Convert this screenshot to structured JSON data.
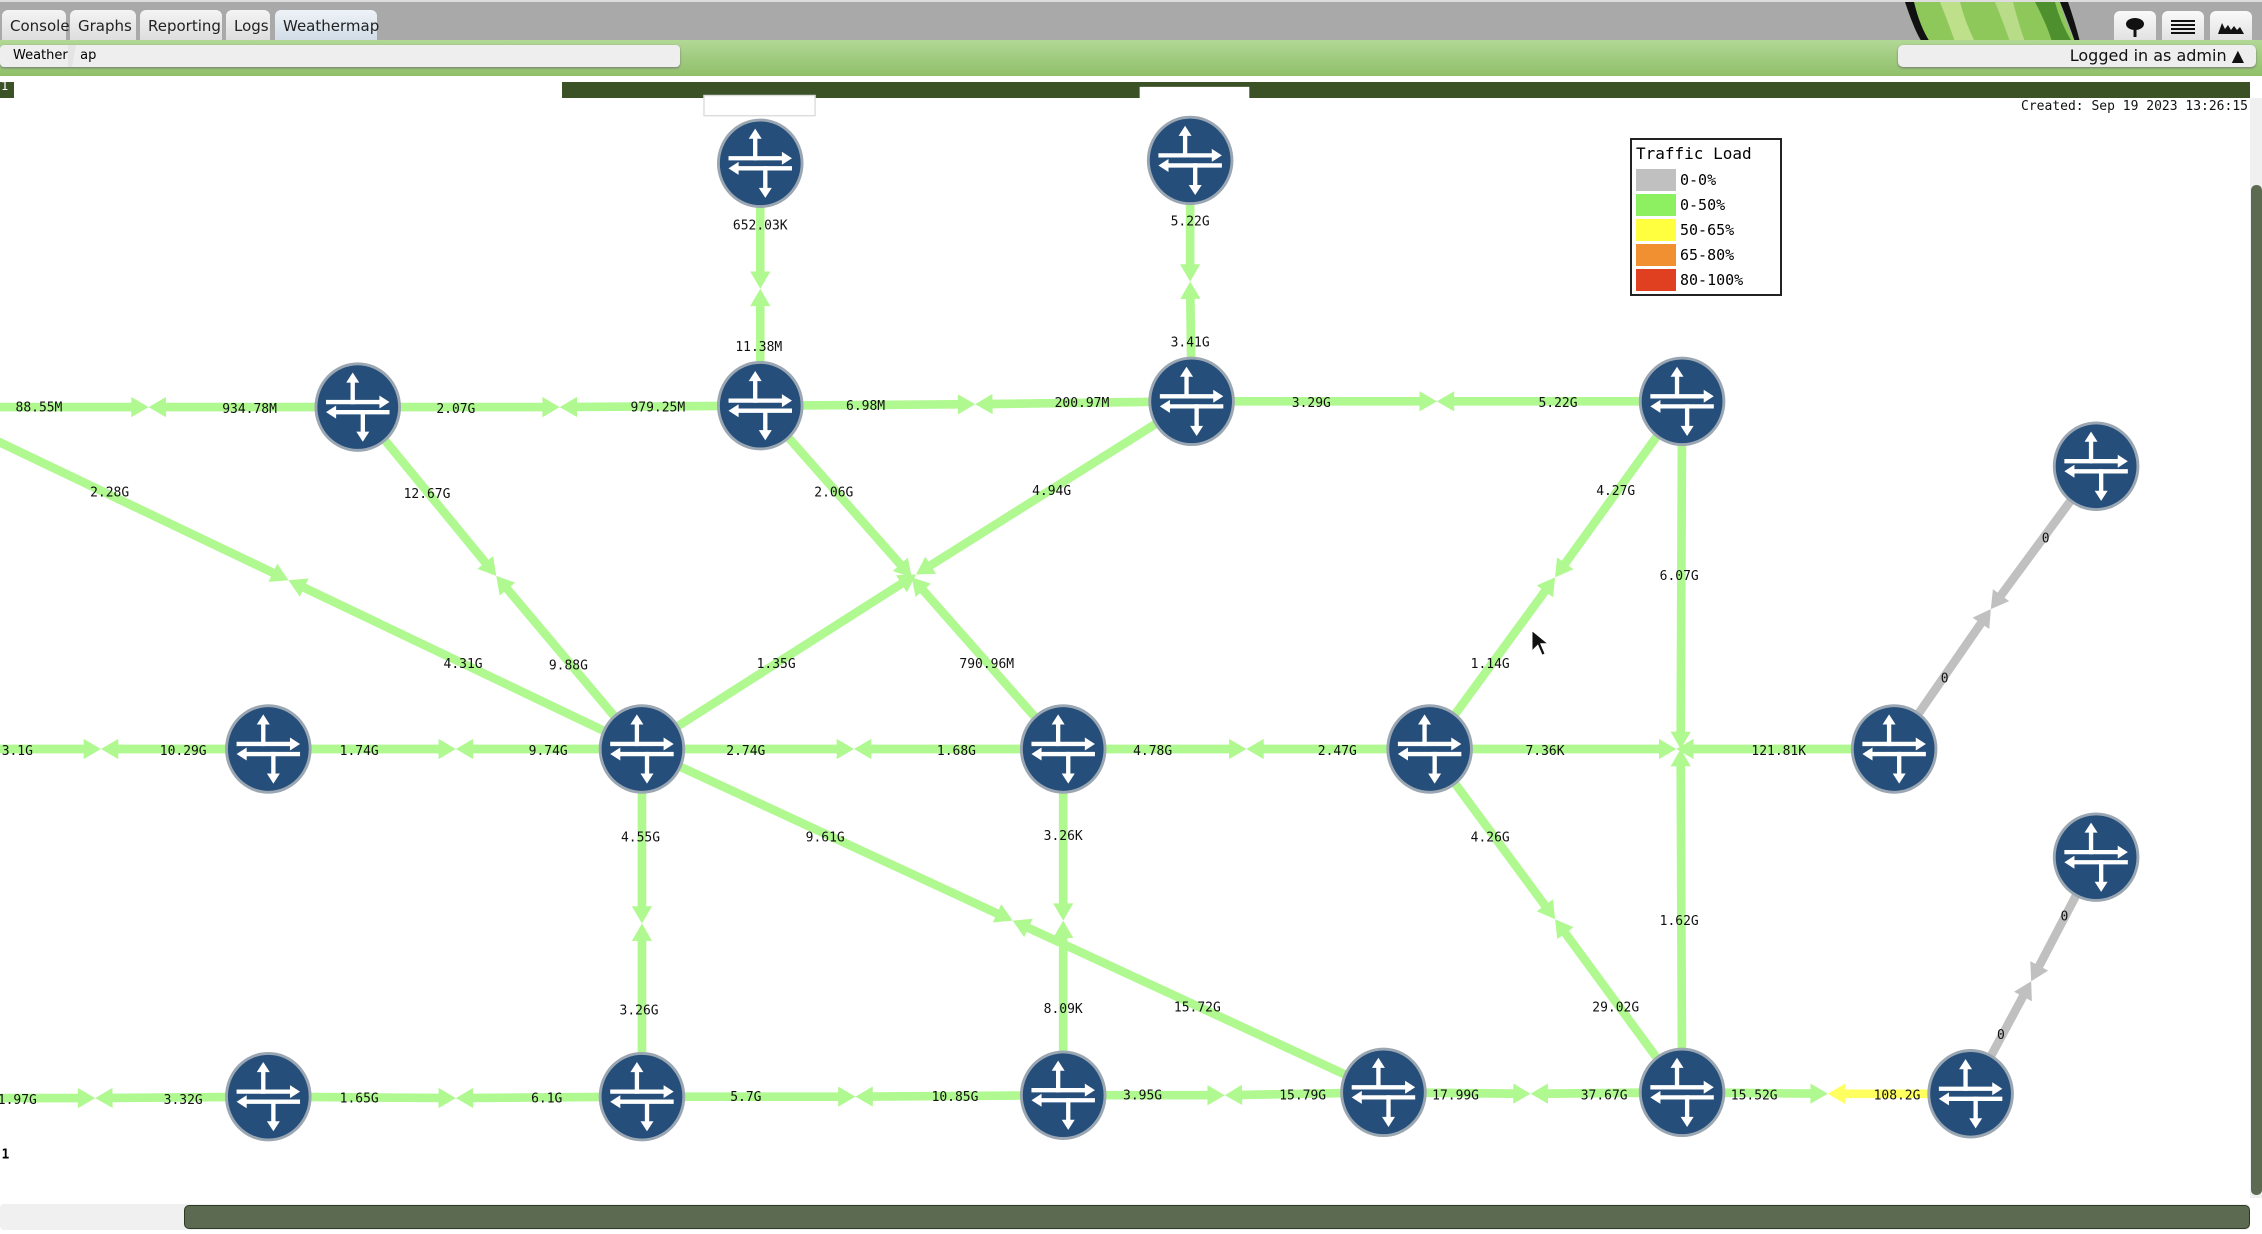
{
  "nav": {
    "tabs": [
      {
        "label": "Console",
        "active": false
      },
      {
        "label": "Graphs",
        "active": false
      },
      {
        "label": "Reporting",
        "active": false
      },
      {
        "label": "Logs",
        "active": false
      },
      {
        "label": "Weathermap",
        "active": true
      }
    ],
    "icons": [
      "tree-icon",
      "menu-icon",
      "chart-icon"
    ],
    "breadcrumb": "Weathermap",
    "login_text": "Logged in as admin ▲"
  },
  "map": {
    "corner_label_top": "1",
    "corner_label_bottom": "1",
    "created": "Created: Sep 19 2023 13:26:15",
    "node_icon": "router-icon",
    "node_color": "#254e7a",
    "legend": {
      "title": "Traffic Load",
      "items": [
        {
          "label": "0-0%",
          "color": "#c0c0c0"
        },
        {
          "label": "0-50%",
          "color": "#8cf060"
        },
        {
          "label": "50-65%",
          "color": "#ffff40"
        },
        {
          "label": "65-80%",
          "color": "#f09030"
        },
        {
          "label": "80-100%",
          "color": "#e04020"
        }
      ]
    },
    "links": [
      {
        "a": "88.55M",
        "b": "934.78M",
        "a_load": "0-50%",
        "b_load": "0-50%"
      },
      {
        "a": "2.07G",
        "b": "979.25M",
        "a_load": "0-50%",
        "b_load": "0-50%"
      },
      {
        "a": "6.98M",
        "b": "200.97M",
        "a_load": "0-50%",
        "b_load": "0-50%"
      },
      {
        "a": "3.29G",
        "b": "5.22G",
        "a_load": "0-50%",
        "b_load": "0-50%"
      },
      {
        "a": "652.03K",
        "b": "11.38M",
        "a_load": "0-50%",
        "b_load": "0-50%"
      },
      {
        "a": "5.22G",
        "b": "3.41G",
        "a_load": "0-50%",
        "b_load": "0-50%"
      },
      {
        "a": "2.28G",
        "b": "4.31G",
        "a_load": "0-50%",
        "b_load": "0-50%"
      },
      {
        "a": "12.67G",
        "b": "9.88G",
        "a_load": "0-50%",
        "b_load": "0-50%"
      },
      {
        "a": "2.06G",
        "b": "790.96M",
        "a_load": "0-50%",
        "b_load": "0-50%"
      },
      {
        "a": "4.94G",
        "b": "1.35G",
        "a_load": "0-50%",
        "b_load": "0-50%"
      },
      {
        "a": "4.27G",
        "b": "1.14G",
        "a_load": "0-50%",
        "b_load": "0-50%"
      },
      {
        "a": "6.07G",
        "b": "1.62G",
        "a_load": "0-50%",
        "b_load": "0-50%"
      },
      {
        "a": "0",
        "b": "0",
        "a_load": "0-0%",
        "b_load": "0-0%"
      },
      {
        "a": "3.1G",
        "b": "10.29G",
        "a_load": "0-50%",
        "b_load": "0-50%"
      },
      {
        "a": "1.74G",
        "b": "9.74G",
        "a_load": "0-50%",
        "b_load": "0-50%"
      },
      {
        "a": "2.74G",
        "b": "1.68G",
        "a_load": "0-50%",
        "b_load": "0-50%"
      },
      {
        "a": "4.78G",
        "b": "2.47G",
        "a_load": "0-50%",
        "b_load": "0-50%"
      },
      {
        "a": "7.36K",
        "b": "121.81K",
        "a_load": "0-50%",
        "b_load": "0-50%"
      },
      {
        "a": "4.55G",
        "b": "3.26G",
        "a_load": "0-50%",
        "b_load": "0-50%"
      },
      {
        "a": "9.61G",
        "b": "15.72G",
        "a_load": "0-50%",
        "b_load": "0-50%"
      },
      {
        "a": "3.26K",
        "b": "8.09K",
        "a_load": "0-50%",
        "b_load": "0-50%"
      },
      {
        "a": "4.26G",
        "b": "29.02G",
        "a_load": "0-50%",
        "b_load": "0-50%"
      },
      {
        "a": "0",
        "b": "0",
        "a_load": "0-0%",
        "b_load": "0-0%"
      },
      {
        "a": "1.97G",
        "b": "3.32G",
        "a_load": "0-50%",
        "b_load": "0-50%"
      },
      {
        "a": "1.65G",
        "b": "6.1G",
        "a_load": "0-50%",
        "b_load": "0-50%"
      },
      {
        "a": "5.7G",
        "b": "10.85G",
        "a_load": "0-50%",
        "b_load": "0-50%"
      },
      {
        "a": "3.95G",
        "b": "15.79G",
        "a_load": "0-50%",
        "b_load": "0-50%"
      },
      {
        "a": "17.99G",
        "b": "37.67G",
        "a_load": "0-50%",
        "b_load": "0-50%"
      },
      {
        "a": "15.52G",
        "b": "108.2G",
        "a_load": "0-50%",
        "b_load": "50-65%"
      }
    ]
  }
}
